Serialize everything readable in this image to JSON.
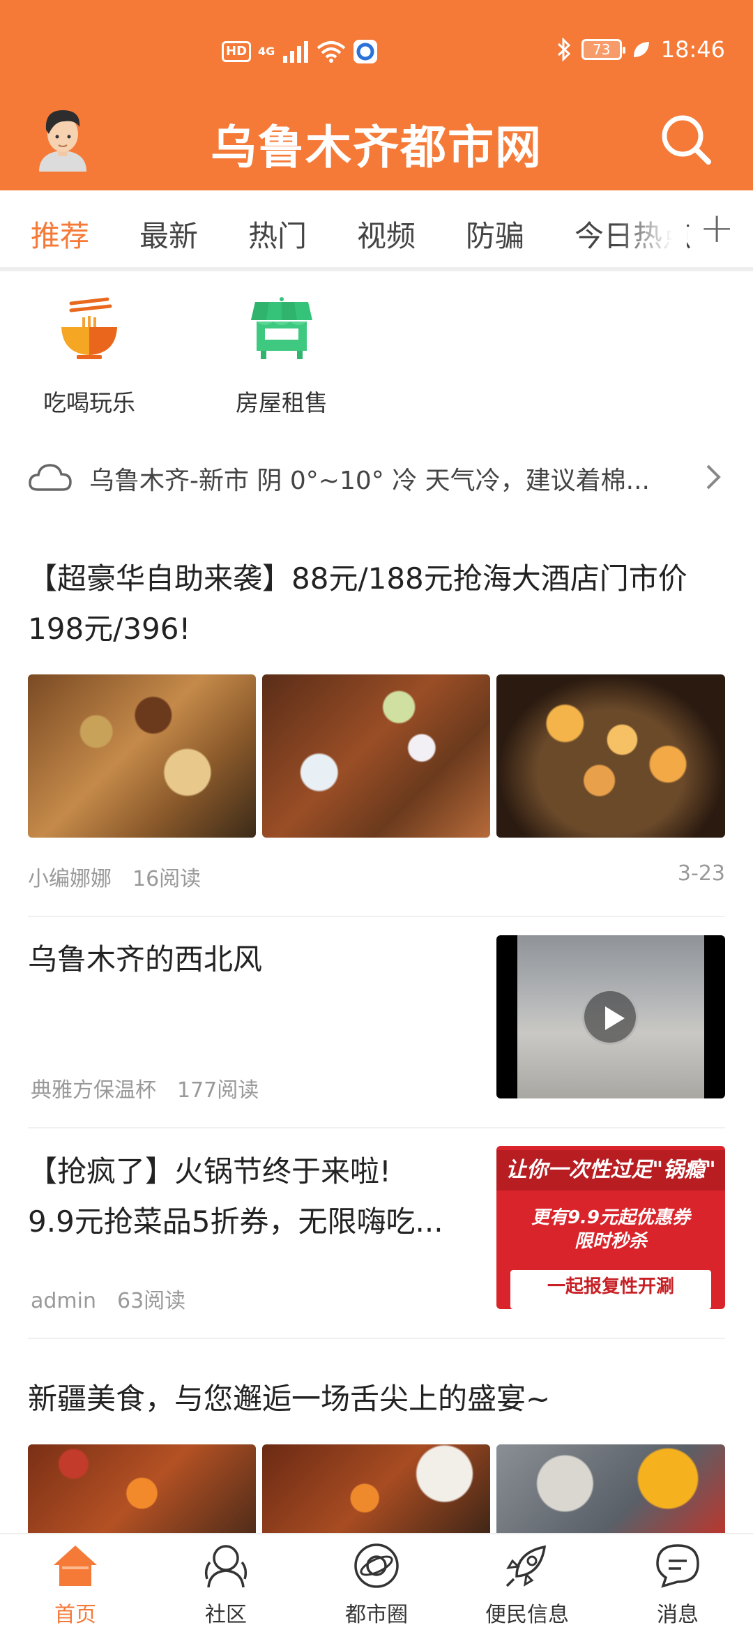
{
  "status_bar": {
    "network": "4G",
    "hd": "HD",
    "battery": "73",
    "time": "18:46"
  },
  "header": {
    "title": "乌鲁木齐都市网",
    "accent": "#f57a38"
  },
  "tabs": [
    {
      "label": "推荐",
      "active": true
    },
    {
      "label": "最新"
    },
    {
      "label": "热门"
    },
    {
      "label": "视频"
    },
    {
      "label": "防骗"
    },
    {
      "label": "今日热点"
    }
  ],
  "quick_links": [
    {
      "label": "吃喝玩乐",
      "icon": "noodle-bowl-icon"
    },
    {
      "label": "房屋租售",
      "icon": "shop-stall-icon"
    }
  ],
  "weather": {
    "text": "乌鲁木齐-新市 阴 0°~10° 冷 天气冷，建议着棉..."
  },
  "articles": [
    {
      "title": "【超豪华自助来袭】88元/188元抢海大酒店门市价198元/396!",
      "author": "小编娜娜",
      "reads": "16阅读",
      "date": "3-23"
    },
    {
      "title": "乌鲁木齐的西北风",
      "author": "典雅方保温杯",
      "reads": "177阅读"
    },
    {
      "title_line1": "【抢疯了】火锅节终于来啦!",
      "title_line2": "9.9元抢菜品5折券，无限嗨吃...",
      "author": "admin",
      "reads": "63阅读",
      "thumb": {
        "line1": "让你一次性过足\"锅瘾\"",
        "line2": "更有9.9元起优惠券",
        "line3": "限时秒杀",
        "line4": "一起报复性开涮"
      }
    },
    {
      "title": "新疆美食，与您邂逅一场舌尖上的盛宴~"
    }
  ],
  "bottom_nav": [
    {
      "label": "首页",
      "active": true
    },
    {
      "label": "社区"
    },
    {
      "label": "都市圈"
    },
    {
      "label": "便民信息"
    },
    {
      "label": "消息"
    }
  ]
}
